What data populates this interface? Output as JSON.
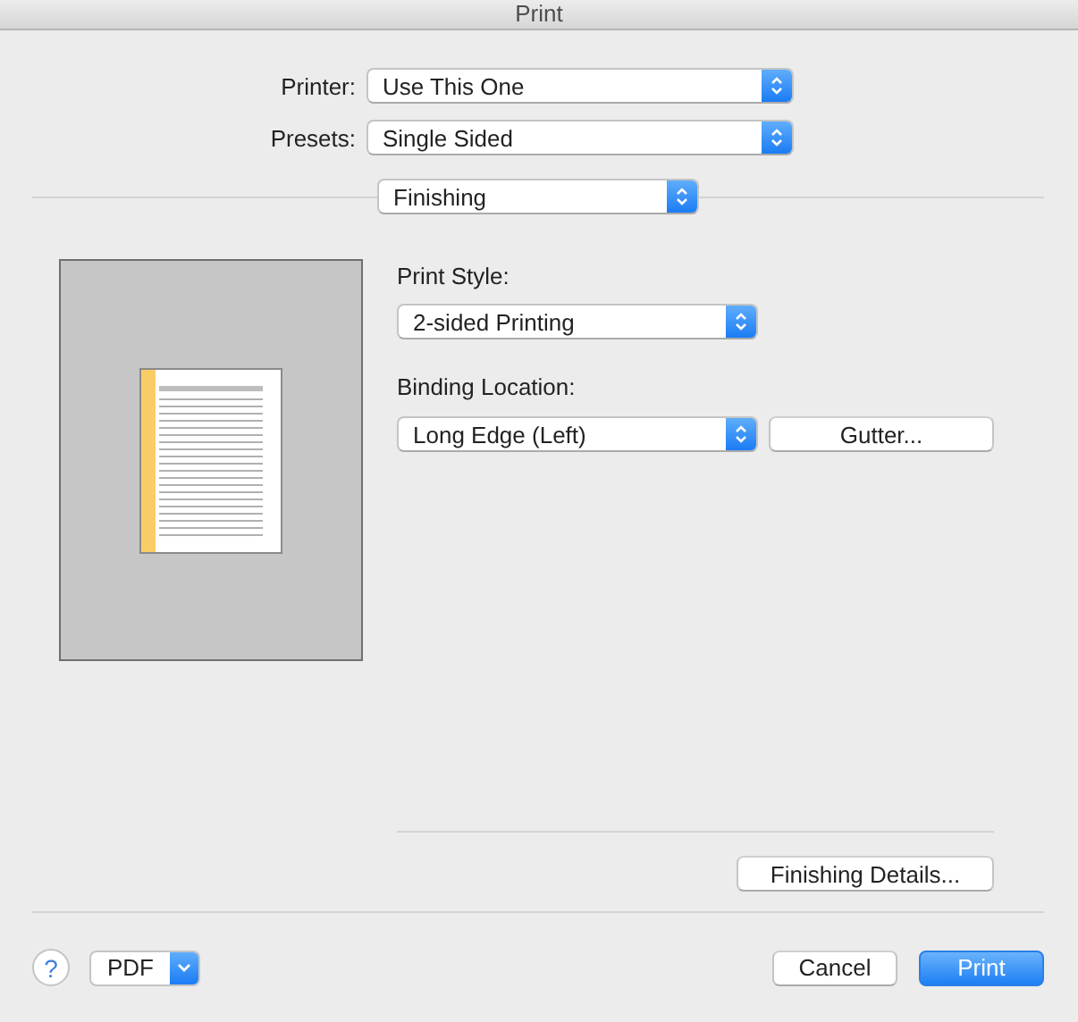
{
  "window": {
    "title": "Print"
  },
  "printer": {
    "label": "Printer:",
    "value": "Use This One"
  },
  "presets": {
    "label": "Presets:",
    "value": "Single Sided"
  },
  "panel_menu": {
    "value": "Finishing"
  },
  "finishing": {
    "print_style": {
      "label": "Print Style:",
      "value": "2-sided Printing"
    },
    "binding_location": {
      "label": "Binding Location:",
      "value": "Long Edge (Left)"
    },
    "gutter_button": "Gutter...",
    "details_button": "Finishing Details..."
  },
  "footer": {
    "help": "?",
    "pdf": "PDF",
    "buttons": [
      {
        "label": "Cancel",
        "kind": "push"
      },
      {
        "label": "Print",
        "kind": "default"
      }
    ]
  }
}
